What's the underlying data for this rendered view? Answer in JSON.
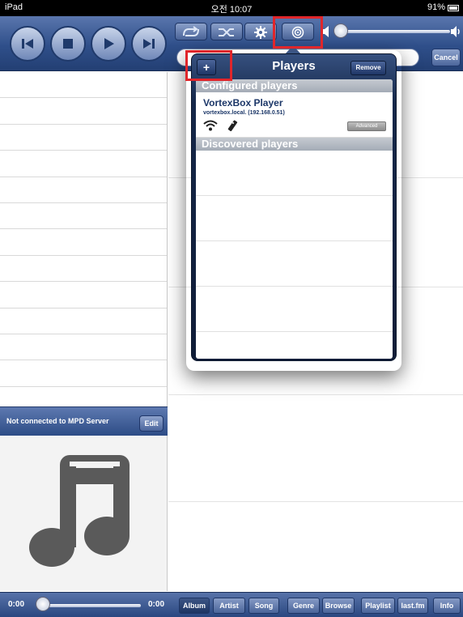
{
  "status_bar": {
    "device": "iPad",
    "time": "오전 10:07",
    "battery": "91%"
  },
  "toolbar": {
    "prev_icon": "skip-previous-icon",
    "stop_icon": "stop-icon",
    "play_icon": "play-icon",
    "next_icon": "skip-next-icon",
    "repeat_icon": "repeat-icon",
    "shuffle_icon": "shuffle-icon",
    "settings_icon": "gear-icon",
    "players_icon": "target-icon",
    "cancel_label": "Cancel"
  },
  "popover": {
    "title": "Players",
    "add_label": "+",
    "remove_label": "Remove",
    "configured_header": "Configured players",
    "discovered_header": "Discovered players",
    "players": [
      {
        "name": "VortexBox Player",
        "host": "vortexbox.local.   (192.168.0.51)",
        "advanced_label": "Advanced"
      }
    ]
  },
  "left_panel": {
    "status_text": "Not connected to MPD Server",
    "edit_label": "Edit",
    "artwork_icon": "music-note-icon"
  },
  "bottom_bar": {
    "elapsed": "0:00",
    "total": "0:00",
    "tabs": [
      {
        "label": "Album",
        "selected": true
      },
      {
        "label": "Artist",
        "selected": false
      },
      {
        "label": "Song",
        "selected": false
      },
      {
        "label": "Genre",
        "selected": false
      },
      {
        "label": "Browse",
        "selected": false
      },
      {
        "label": "Playlist",
        "selected": false
      },
      {
        "label": "last.fm",
        "selected": false
      },
      {
        "label": "Info",
        "selected": false
      }
    ]
  },
  "colors": {
    "toolbar": "#2f4f8a",
    "highlight": "#e0262b"
  }
}
